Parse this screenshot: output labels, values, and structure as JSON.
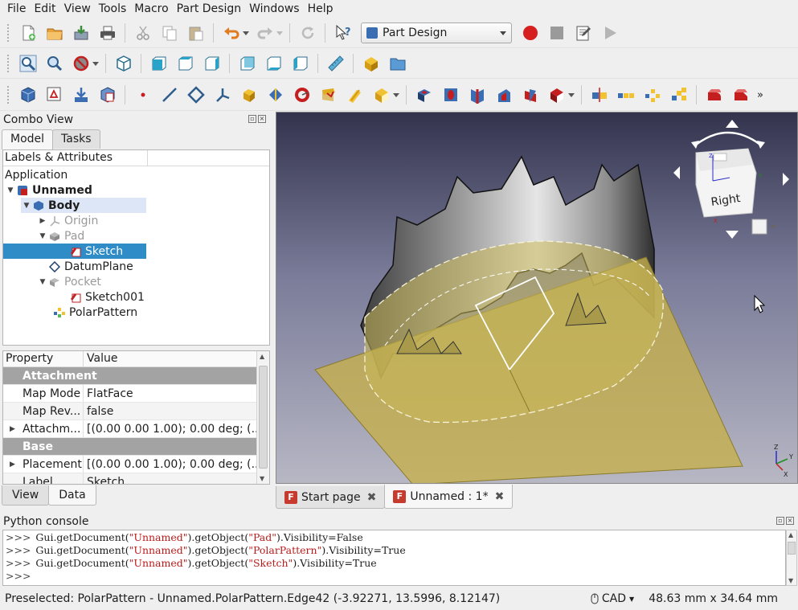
{
  "menu": [
    {
      "label": "File",
      "underline": "F"
    },
    {
      "label": "Edit",
      "underline": "E"
    },
    {
      "label": "View",
      "underline": "V"
    },
    {
      "label": "Tools",
      "underline": "T"
    },
    {
      "label": "Macro",
      "underline": "M"
    },
    {
      "label": "Part Design",
      "underline": "P"
    },
    {
      "label": "Windows",
      "underline": "W"
    },
    {
      "label": "Help",
      "underline": "H"
    }
  ],
  "workbench": {
    "selected": "Part Design"
  },
  "combo_view": {
    "title": "Combo View",
    "tabs": [
      "Model",
      "Tasks"
    ],
    "tree_header": "Labels & Attributes",
    "tree_root": "Application",
    "tree": [
      {
        "label": "Unnamed",
        "icon": "document-icon"
      },
      {
        "label": "Body",
        "icon": "body-icon"
      },
      {
        "label": "Origin",
        "icon": "origin-icon"
      },
      {
        "label": "Pad",
        "icon": "pad-icon"
      },
      {
        "label": "Sketch",
        "icon": "sketch-icon"
      },
      {
        "label": "DatumPlane",
        "icon": "datum-plane-icon"
      },
      {
        "label": "Pocket",
        "icon": "pocket-icon"
      },
      {
        "label": "Sketch001",
        "icon": "sketch-icon"
      },
      {
        "label": "PolarPattern",
        "icon": "polar-pattern-icon"
      }
    ],
    "property_header": {
      "property": "Property",
      "value": "Value"
    },
    "properties": [
      {
        "type": "group",
        "name": "Attachment"
      },
      {
        "type": "prop",
        "name": "Map Mode",
        "value": "FlatFace"
      },
      {
        "type": "prop",
        "name": "Map Rev...",
        "value": "false"
      },
      {
        "type": "prop",
        "name": "Attachm...",
        "value": "[(0.00 0.00 1.00); 0.00 deg; (..."
      },
      {
        "type": "group",
        "name": "Base"
      },
      {
        "type": "prop",
        "name": "Placement",
        "value": "[(0.00 0.00 1.00); 0.00 deg; (..."
      },
      {
        "type": "prop",
        "name": "Label",
        "value": "Sketch"
      }
    ],
    "bottom_tabs": [
      "View",
      "Data"
    ]
  },
  "view3d": {
    "navcube_face": "Right"
  },
  "document_tabs": [
    {
      "label": "Start page",
      "active": false
    },
    {
      "label": "Unnamed : 1*",
      "active": true
    }
  ],
  "python_console": {
    "title": "Python console",
    "prompt": ">>>",
    "lines": [
      {
        "a": "Gui.getDocument(",
        "s1": "\"Unnamed\"",
        "b": ").getObject(",
        "s2": "\"Pad\"",
        "c": ").Visibility=False"
      },
      {
        "a": "Gui.getDocument(",
        "s1": "\"Unnamed\"",
        "b": ").getObject(",
        "s2": "\"PolarPattern\"",
        "c": ").Visibility=True"
      },
      {
        "a": "Gui.getDocument(",
        "s1": "\"Unnamed\"",
        "b": ").getObject(",
        "s2": "\"Sketch\"",
        "c": ").Visibility=True"
      }
    ]
  },
  "status": {
    "text": "Preselected: PolarPattern - Unnamed.PolarPattern.Edge42 (-3.92271, 13.5996, 8.12147)",
    "nav_style": "CAD",
    "dimensions": "48.63 mm x 34.64 mm"
  }
}
